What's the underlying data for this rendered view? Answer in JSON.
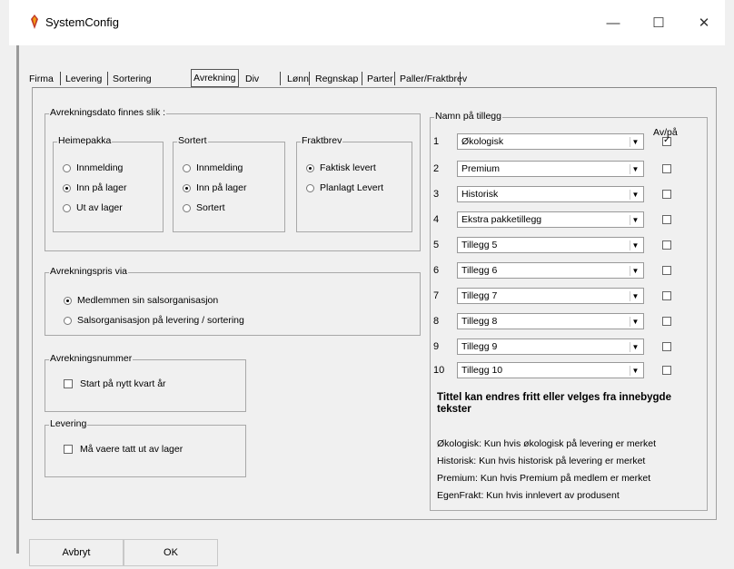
{
  "window": {
    "title": "SystemConfig"
  },
  "tabs": [
    "Firma",
    "Levering",
    "Sortering",
    "Avrekning",
    "Div",
    "Lønn",
    "Regnskap",
    "Parter",
    "Paller/Fraktbrev"
  ],
  "selected_tab": "Avrekning",
  "avrekningsdato": {
    "label": "Avrekningsdato finnes slik :",
    "heimepakka": {
      "label": "Heimepakka",
      "options": [
        "Innmelding",
        "Inn på lager",
        "Ut av lager"
      ],
      "selected": "Inn på lager"
    },
    "sortert": {
      "label": "Sortert",
      "options": [
        "Innmelding",
        "Inn på lager",
        "Sortert"
      ],
      "selected": "Inn på lager"
    },
    "fraktbrev": {
      "label": "Fraktbrev",
      "options": [
        "Faktisk levert",
        "Planlagt Levert"
      ],
      "selected": "Faktisk levert"
    }
  },
  "avrekningspris": {
    "label": "Avrekningspris via",
    "options": [
      "Medlemmen sin salsorganisasjon",
      "Salsorganisasjon på levering / sortering"
    ],
    "selected": "Medlemmen sin salsorganisasjon"
  },
  "avrekningsnummer": {
    "label": "Avrekningsnummer",
    "checkbox_label": "Start på nytt kvart år",
    "checked": false
  },
  "levering": {
    "label": "Levering",
    "checkbox_label": "Må vaere tatt ut av lager",
    "checked": false
  },
  "tillegg": {
    "label": "Namn på tillegg",
    "avpa_label": "Av/på",
    "rows": [
      {
        "num": "1",
        "value": "Økologisk",
        "checked": true
      },
      {
        "num": "2",
        "value": "Premium",
        "checked": false
      },
      {
        "num": "3",
        "value": "Historisk",
        "checked": false
      },
      {
        "num": "4",
        "value": "Ekstra pakketillegg",
        "checked": false
      },
      {
        "num": "5",
        "value": "Tillegg 5",
        "checked": false
      },
      {
        "num": "6",
        "value": "Tillegg 6",
        "checked": false
      },
      {
        "num": "7",
        "value": "Tillegg 7",
        "checked": false
      },
      {
        "num": "8",
        "value": "Tillegg 8",
        "checked": false
      },
      {
        "num": "9",
        "value": "Tillegg 9",
        "checked": false
      },
      {
        "num": "10",
        "value": "Tillegg 10",
        "checked": false
      }
    ],
    "note_title": "Tittel kan endres fritt eller velges fra innebygde tekster",
    "notes": [
      "Økologisk: Kun hvis økologisk på levering er merket",
      "Historisk: Kun hvis historisk på levering er merket",
      "Premium: Kun hvis Premium på medlem er merket",
      "EgenFrakt: Kun hvis innlevert av produsent"
    ]
  },
  "buttons": {
    "cancel": "Avbryt",
    "ok": "OK"
  }
}
